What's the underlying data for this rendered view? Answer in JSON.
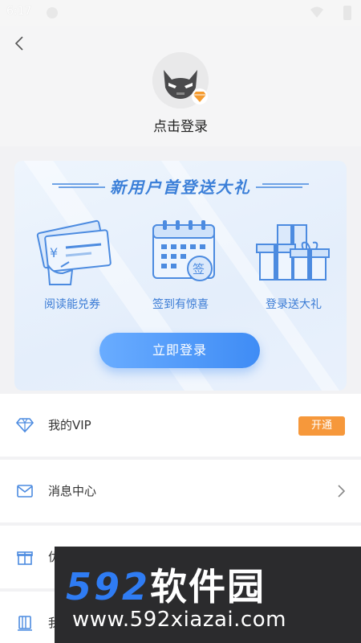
{
  "status_bar": {
    "time": "6:17"
  },
  "header": {
    "login_prompt": "点击登录"
  },
  "banner": {
    "title": "新用户首登送大礼",
    "perks": [
      {
        "label": "阅读能兑券",
        "icon": "ticket-icon"
      },
      {
        "label": "签到有惊喜",
        "icon": "calendar-icon"
      },
      {
        "label": "登录送大礼",
        "icon": "gift-boxes-icon"
      }
    ],
    "calendar_stamp": "签",
    "ticket_currency": "¥",
    "login_button": "立即登录"
  },
  "menu": [
    {
      "label": "我的VIP",
      "icon": "diamond-icon",
      "badge": "开通"
    },
    {
      "label": "消息中心",
      "icon": "mail-icon"
    },
    {
      "label": "优",
      "icon": "gift-icon"
    },
    {
      "label": "我",
      "icon": "books-icon"
    }
  ],
  "watermark": {
    "logo_number": "592",
    "logo_text": "软件园",
    "url": "www.592xiazai.com"
  },
  "colors": {
    "accent_blue": "#3f8cf5",
    "badge_orange": "#f6983b",
    "title_blue": "#3b7fd8"
  }
}
